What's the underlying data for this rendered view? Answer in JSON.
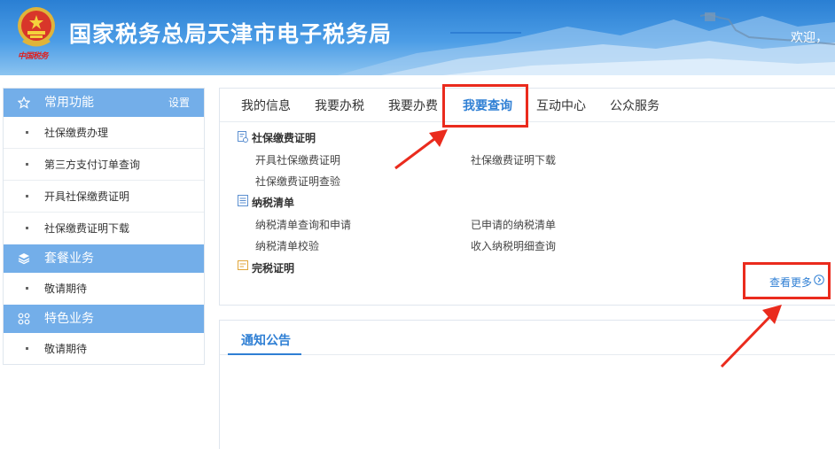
{
  "header": {
    "site_title": "国家税务总局天津市电子税务局",
    "welcome": "欢迎，",
    "brand_color": "#2a7fd3"
  },
  "sidebar": {
    "groups": [
      {
        "title": "常用功能",
        "icon": "star-icon",
        "setting": "设置",
        "items": [
          "社保缴费办理",
          "第三方支付订单查询",
          "开具社保缴费证明",
          "社保缴费证明下载"
        ]
      },
      {
        "title": "套餐业务",
        "icon": "layers-icon",
        "items": [
          "敬请期待"
        ]
      },
      {
        "title": "特色业务",
        "icon": "grid-icon",
        "items": [
          "敬请期待"
        ]
      }
    ]
  },
  "tabs": [
    "我的信息",
    "我要办税",
    "我要办费",
    "我要查询",
    "互动中心",
    "公众服务"
  ],
  "active_tab": "我要查询",
  "sections": [
    {
      "title": "社保缴费证明",
      "icon": "certificate-icon",
      "links": [
        "开具社保缴费证明",
        "社保缴费证明下载",
        "社保缴费证明查验"
      ]
    },
    {
      "title": "纳税清单",
      "icon": "list-icon",
      "links": [
        "纳税清单查询和申请",
        "已申请的纳税清单",
        "纳税清单校验",
        "收入纳税明细查询"
      ]
    },
    {
      "title": "完税证明",
      "icon": "tax-certificate-icon",
      "links": []
    }
  ],
  "more_link": "查看更多",
  "notice": {
    "tab": "通知公告"
  },
  "colors": {
    "accent": "#2f7fd4",
    "sidebar_header": "#73aee9",
    "annotation": "#ea2b1d"
  }
}
